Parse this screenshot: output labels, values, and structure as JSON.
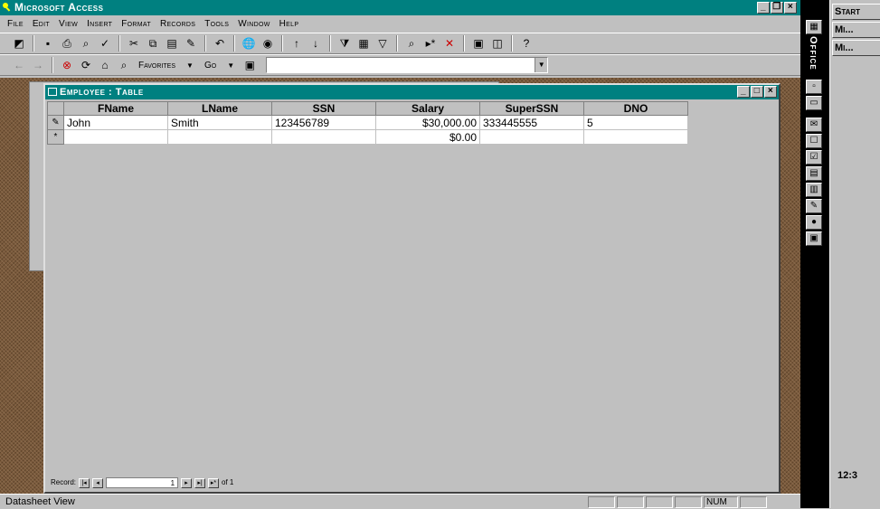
{
  "app": {
    "title": "Microsoft Access"
  },
  "menubar": [
    "File",
    "Edit",
    "View",
    "Insert",
    "Format",
    "Records",
    "Tools",
    "Window",
    "Help"
  ],
  "web_toolbar": {
    "favorites": "Favorites",
    "go": "Go",
    "address": ""
  },
  "table_window": {
    "title": "Employee : Table",
    "columns": [
      "FName",
      "LName",
      "SSN",
      "Salary",
      "SuperSSN",
      "DNO"
    ],
    "rows": [
      {
        "selector": "✎",
        "FName": "John",
        "LName": "Smith",
        "SSN": "123456789",
        "Salary": "$30,000.00",
        "SuperSSN": "333445555",
        "DNO": "5"
      },
      {
        "selector": "*",
        "FName": "",
        "LName": "",
        "SSN": "",
        "Salary": "$0.00",
        "SuperSSN": "",
        "DNO": ""
      }
    ],
    "record_nav": {
      "label": "Record:",
      "current": "1",
      "of": "of 1"
    }
  },
  "statusbar": {
    "text": "Datasheet View",
    "num": "NUM"
  },
  "office_bar": {
    "title": "Office"
  },
  "taskbar": {
    "start": "Start",
    "items": [
      "Mi...",
      "Mi..."
    ],
    "clock": "12:3"
  },
  "colors": {
    "titlebar": "#008080",
    "chrome": "#c0c0c0",
    "desktop_pattern": "#7a5a3c"
  }
}
